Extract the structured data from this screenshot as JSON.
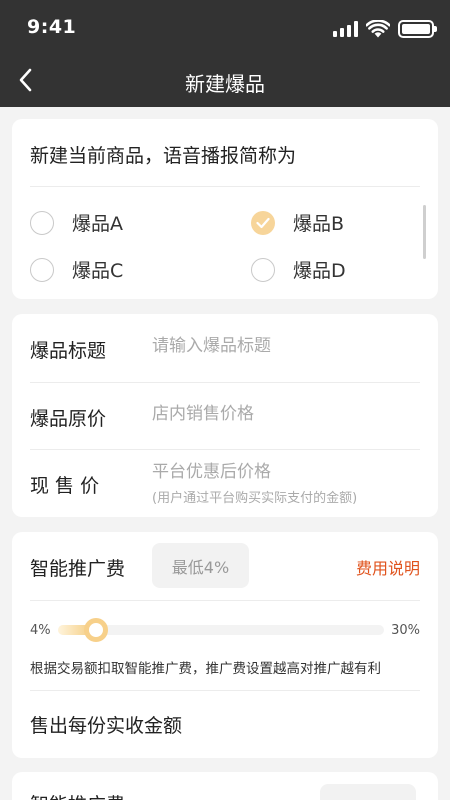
{
  "status_bar": {
    "time": "9:41",
    "icons": [
      "signal-icon",
      "wifi-icon",
      "battery-icon"
    ]
  },
  "nav": {
    "title": "新建爆品",
    "back_icon": "chevron-left-icon"
  },
  "voice_section": {
    "title": "新建当前商品，语音播报简称为",
    "options": [
      {
        "label": "爆品A",
        "checked": false
      },
      {
        "label": "爆品B",
        "checked": true
      },
      {
        "label": "爆品C",
        "checked": false
      },
      {
        "label": "爆品D",
        "checked": false
      }
    ]
  },
  "product_form": {
    "title_label": "爆品标题",
    "title_placeholder": "请输入爆品标题",
    "price_label": "爆品原价",
    "price_placeholder": "店内销售价格",
    "current_label": "现 售 价",
    "current_placeholder": "平台优惠后价格",
    "current_hint": "(用户通过平台购买实际支付的金额)"
  },
  "promotion": {
    "label": "智能推广费",
    "min_text": "最低4%",
    "fee_link": "费用说明",
    "slider_min_label": "4%",
    "slider_max_label": "30%",
    "slider_min": 4,
    "slider_max": 30,
    "slider_value": 7,
    "hint": "根据交易额扣取智能推广费，推广费设置越高对推广越有利",
    "receive_label": "售出每份实收金额"
  },
  "next_card": {
    "label": "智能推广费"
  },
  "colors": {
    "header_bg": "#333333",
    "accent": "#f3c979",
    "link": "#e0531d",
    "page_bg": "#f3f3f3"
  }
}
